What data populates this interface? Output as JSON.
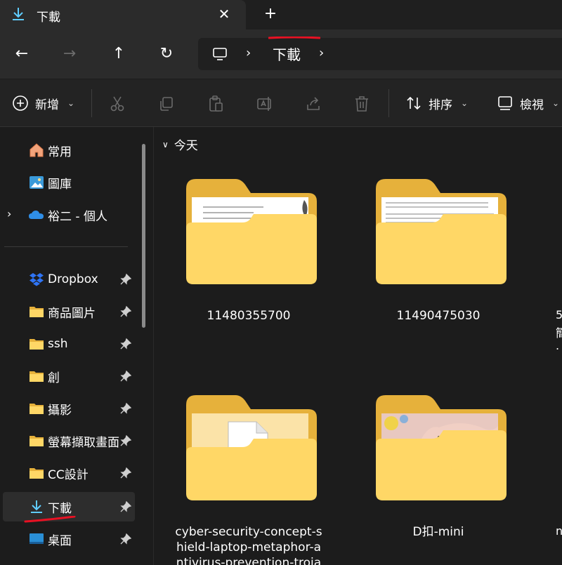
{
  "tab": {
    "title": "下載",
    "close": "✕",
    "new_tab": "+"
  },
  "nav": {
    "back": "←",
    "forward": "→",
    "up": "↑",
    "refresh": "↻",
    "separator": "›",
    "crumb": "下載"
  },
  "toolbar": {
    "new_label": "新增",
    "sort_label": "排序",
    "view_label": "檢視"
  },
  "sidebar": {
    "items": [
      {
        "label": "常用",
        "icon": "home-icon"
      },
      {
        "label": "圖庫",
        "icon": "gallery-icon"
      },
      {
        "label": "裕二 - 個人",
        "icon": "onedrive-icon"
      },
      {
        "label": "Dropbox",
        "icon": "dropbox-icon"
      },
      {
        "label": "商品圖片",
        "icon": "folder-icon"
      },
      {
        "label": "ssh",
        "icon": "folder-icon"
      },
      {
        "label": "創",
        "icon": "folder-icon"
      },
      {
        "label": "攝影",
        "icon": "folder-icon"
      },
      {
        "label": "螢幕擷取畫面",
        "icon": "folder-icon"
      },
      {
        "label": "CC設計",
        "icon": "folder-icon"
      },
      {
        "label": "下載",
        "icon": "download-icon"
      },
      {
        "label": "桌面",
        "icon": "desktop-icon"
      }
    ]
  },
  "content": {
    "group_label": "今天",
    "files": [
      {
        "name": "11480355700"
      },
      {
        "name": "11490475030"
      },
      {
        "name_lines": [
          "cyber-security-concept-s",
          "hield-laptop-metaphor-a",
          "ntivirus-prevention-troja"
        ]
      },
      {
        "name": "D扣-mini"
      }
    ],
    "edge_texts": [
      "5",
      "簡",
      ".",
      "n"
    ]
  },
  "colors": {
    "accent": "#60cdff",
    "folder_back": "#e6b13b",
    "folder_front": "#ffd766",
    "annotation_red": "#e81123"
  }
}
